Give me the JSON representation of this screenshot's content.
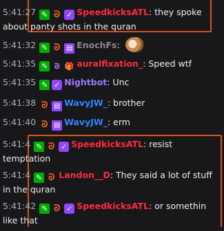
{
  "messages": [
    {
      "time": "5:41:27",
      "user": "SpeedkicksATL",
      "color": "#ff2a3d",
      "text": "they spoke about panty shots in the quran"
    },
    {
      "time": "5:41:32",
      "user": "EnochFs",
      "color": "#8a8a93",
      "text": ""
    },
    {
      "time": "5:41:35",
      "user": "auralfixation_",
      "color": "#ff2a3d",
      "text": "Speed wtf"
    },
    {
      "time": "5:41:35",
      "user": "Nightbot",
      "color": "#9b7bff",
      "text": "Unc"
    },
    {
      "time": "5:41:38",
      "user": "WavyJW_",
      "color": "#2e86ff",
      "text": "brother"
    },
    {
      "time": "5:41:40",
      "user": "WavyJW_",
      "color": "#2e86ff",
      "text": "erm"
    },
    {
      "time": "5:41:4",
      "user": "SpeedkicksATL",
      "color": "#ff2a3d",
      "text": "resist temptation"
    },
    {
      "time": "5:41:4",
      "user": "Landon__D",
      "color": "#ff2a3d",
      "text": "They said a lot of stuff in the quran"
    },
    {
      "time": "5:41:42",
      "user": "SpeedkicksATL",
      "color": "#ff2a3d",
      "text": "or somethin like that"
    }
  ],
  "emote": "hamster-emote",
  "highlight_color": "#d4551e"
}
